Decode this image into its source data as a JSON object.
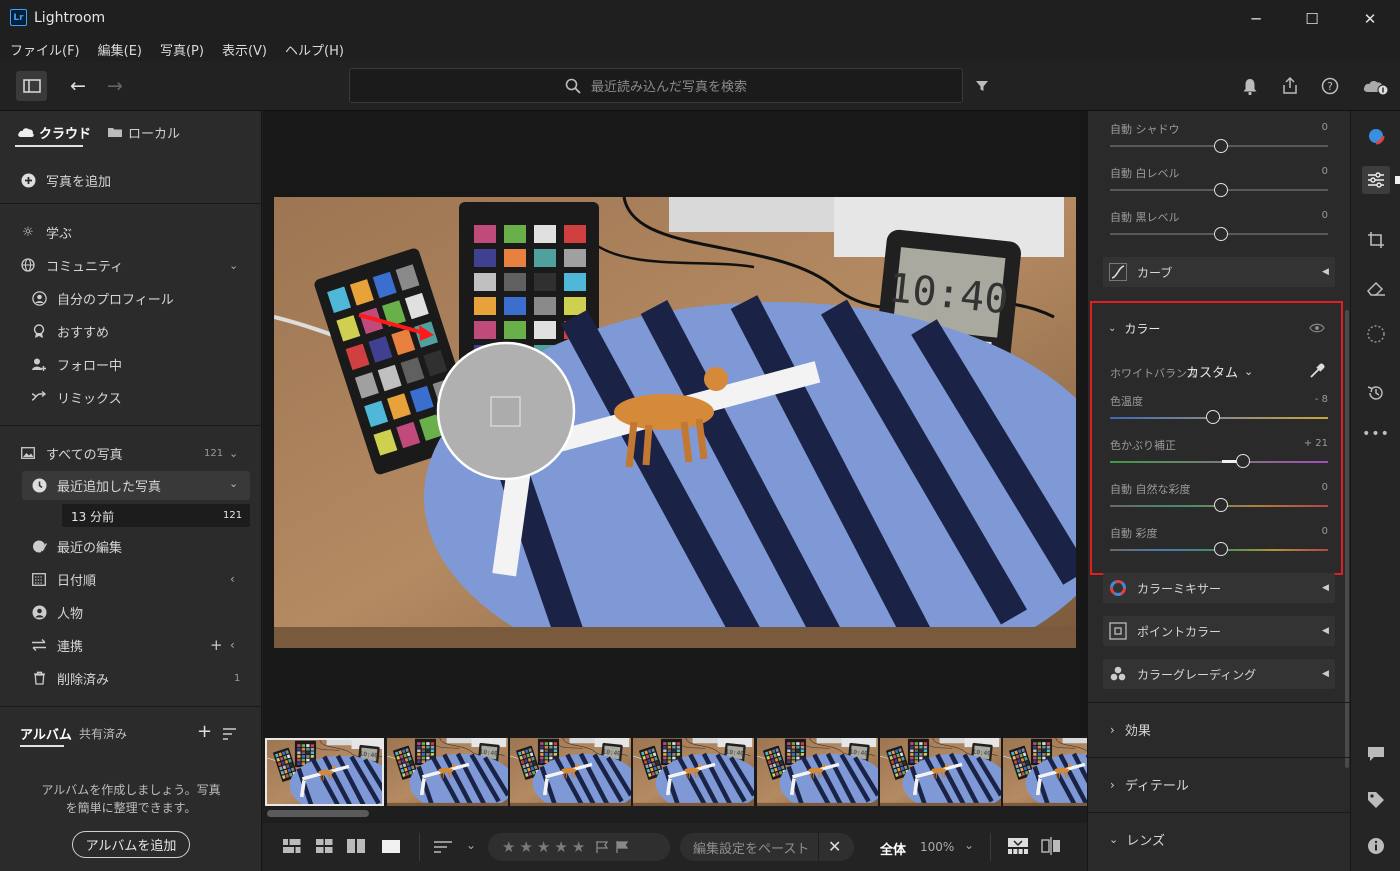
{
  "window": {
    "title": "Lightroom",
    "logo_text": "Lr",
    "minimize": "─",
    "maximize": "☐",
    "close": "✕"
  },
  "menu": [
    "ファイル(F)",
    "編集(E)",
    "写真(P)",
    "表示(V)",
    "ヘルプ(H)"
  ],
  "search": {
    "placeholder": "最近読み込んだ写真を検索"
  },
  "left": {
    "tabs": {
      "cloud": "クラウド",
      "local": "ローカル"
    },
    "add_photos": "写真を追加",
    "learn": "学ぶ",
    "community": "コミュニティ",
    "my_profile": "自分のプロフィール",
    "recommended": "おすすめ",
    "following": "フォロー中",
    "remix": "リミックス",
    "all_photos": "すべての写真",
    "all_photos_count": "121",
    "recent_added": "最近追加した写真",
    "recent_time": "13 分前",
    "recent_count": "121",
    "recent_edits": "最近の編集",
    "by_date": "日付順",
    "people": "人物",
    "connections": "連携",
    "deleted": "削除済み",
    "deleted_count": "1",
    "albums_tab": "アルバム",
    "shared_tab": "共有済み",
    "album_hint": "アルバムを作成しましょう。写真を簡単に整理できます。",
    "add_album": "アルバムを追加"
  },
  "bottom": {
    "paste_settings": "編集設定をペースト",
    "zoom_fit": "全体",
    "zoom_pct": "100%",
    "stars": [
      "★",
      "★",
      "★",
      "★",
      "★"
    ]
  },
  "right": {
    "auto_shadows": "自動 シャドウ",
    "auto_shadows_val": "0",
    "auto_whites": "自動 白レベル",
    "auto_whites_val": "0",
    "auto_blacks": "自動 黒レベル",
    "auto_blacks_val": "0",
    "curve": "カーブ",
    "color_section": "カラー",
    "wb_label": "ホワイトバランス",
    "wb_value": "カスタム",
    "temp_label": "色温度",
    "temp_val": "- 8",
    "tint_label": "色かぶり補正",
    "tint_val": "+ 21",
    "vibrance_label": "自動 自然な彩度",
    "vibrance_val": "0",
    "saturation_label": "自動 彩度",
    "saturation_val": "0",
    "color_mixer": "カラーミキサー",
    "point_color": "ポイントカラー",
    "color_grading": "カラーグレーディング",
    "effects": "効果",
    "detail": "ディテール",
    "lens": "レンズ"
  },
  "colors": {
    "highlight_box": "#e02020",
    "accent_blue": "#3ea0ff"
  }
}
